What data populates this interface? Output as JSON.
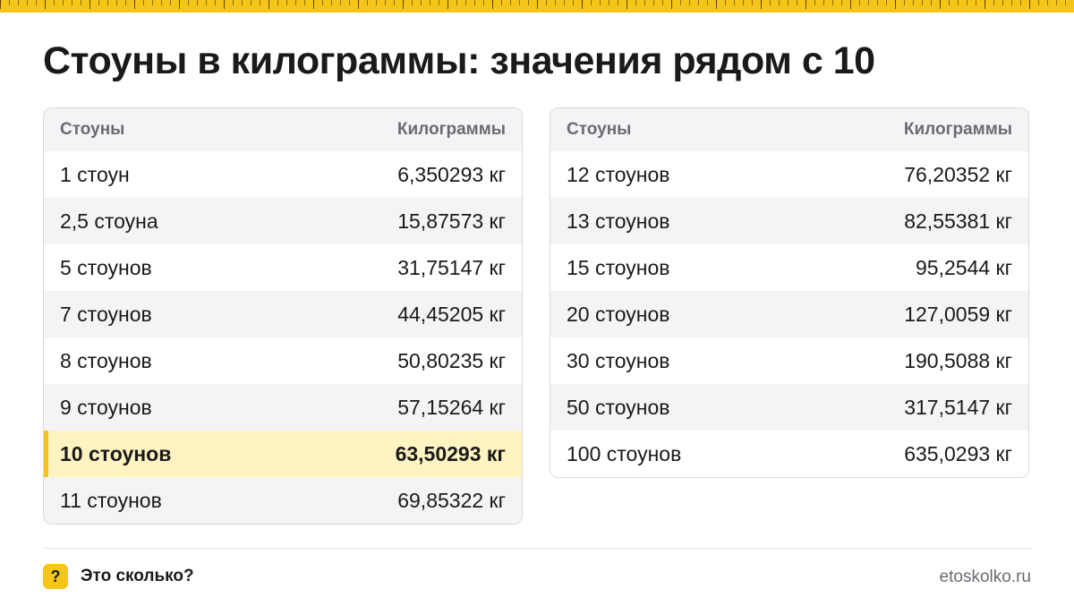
{
  "title": "Стоуны в килограммы: значения рядом с 10",
  "columns": {
    "stones": "Стоуны",
    "kilograms": "Килограммы"
  },
  "left_table": [
    {
      "stones": "1 стоун",
      "kg": "6,350293 кг"
    },
    {
      "stones": "2,5 стоуна",
      "kg": "15,87573 кг"
    },
    {
      "stones": "5 стоунов",
      "kg": "31,75147 кг"
    },
    {
      "stones": "7 стоунов",
      "kg": "44,45205 кг"
    },
    {
      "stones": "8 стоунов",
      "kg": "50,80235 кг"
    },
    {
      "stones": "9 стоунов",
      "kg": "57,15264 кг"
    },
    {
      "stones": "10 стоунов",
      "kg": "63,50293 кг",
      "highlighted": true
    },
    {
      "stones": "11 стоунов",
      "kg": "69,85322 кг"
    }
  ],
  "right_table": [
    {
      "stones": "12 стоунов",
      "kg": "76,20352 кг"
    },
    {
      "stones": "13 стоунов",
      "kg": "82,55381 кг"
    },
    {
      "stones": "15 стоунов",
      "kg": "95,2544 кг"
    },
    {
      "stones": "20 стоунов",
      "kg": "127,0059 кг"
    },
    {
      "stones": "30 стоунов",
      "kg": "190,5088 кг"
    },
    {
      "stones": "50 стоунов",
      "kg": "317,5147 кг"
    },
    {
      "stones": "100 стоунов",
      "kg": "635,0293 кг"
    }
  ],
  "footer": {
    "badge_icon": "question-mark-icon",
    "badge_glyph": "?",
    "brand": "Это сколько?",
    "site": "etoskolko.ru"
  },
  "colors": {
    "accent": "#f5c518",
    "highlight_row": "#fff3c2",
    "alt_row": "#f4f4f6",
    "border": "#d9d9de",
    "muted_text": "#6a6a72"
  }
}
